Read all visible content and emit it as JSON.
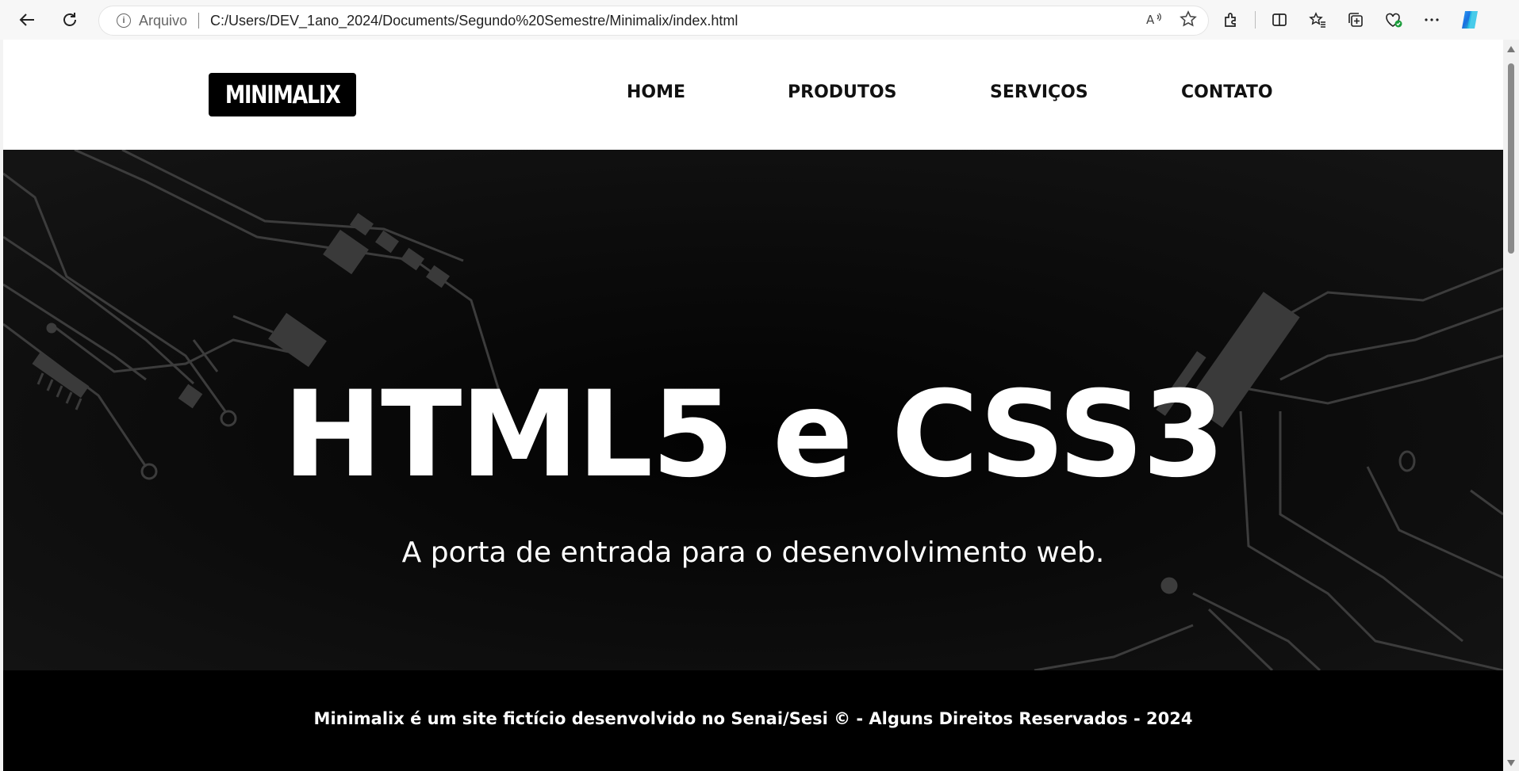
{
  "browser": {
    "address_label": "Arquivo",
    "url": "C:/Users/DEV_1ano_2024/Documents/Segundo%20Semestre/Minimalix/index.html",
    "icons": [
      "back-icon",
      "refresh-icon",
      "info-icon",
      "read-aloud-icon",
      "favorite-star-icon",
      "extensions-icon",
      "split-screen-icon",
      "favorites-icon",
      "collections-icon",
      "browser-essentials-icon",
      "more-icon",
      "copilot-icon"
    ]
  },
  "site": {
    "logo": "MINIMALIX",
    "nav": [
      "HOME",
      "PRODUTOS",
      "SERVIÇOS",
      "CONTATO"
    ],
    "hero_title": "HTML5 e CSS3",
    "hero_subtitle": "A porta de entrada para o desenvolvimento web.",
    "footer": "Minimalix é um site fictício desenvolvido no Senai/Sesi © - Alguns Direitos Reservados - 2024"
  },
  "colors": {
    "header_bg": "#ffffff",
    "hero_bg": "#080808",
    "footer_bg": "#000000",
    "circuit": "#3a3a3a"
  }
}
